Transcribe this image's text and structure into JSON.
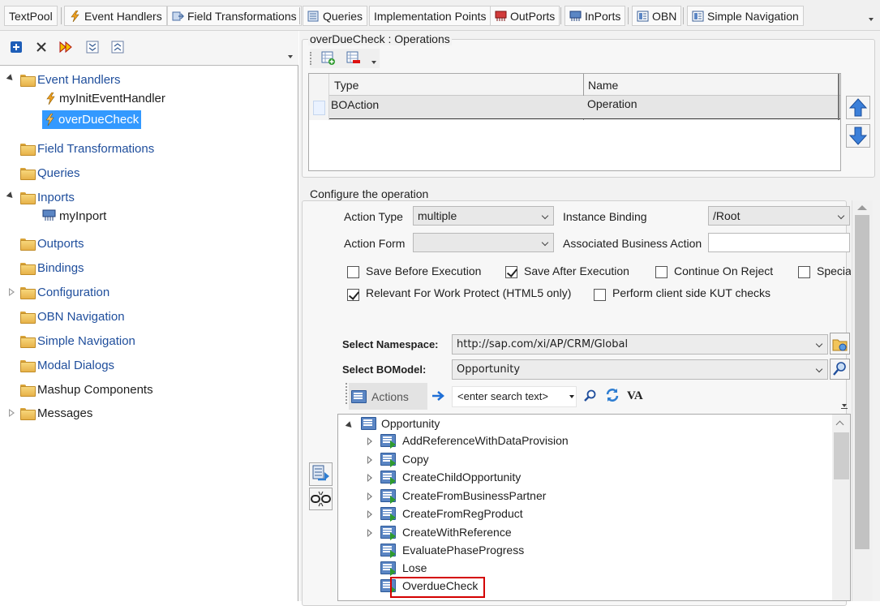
{
  "tabs": [
    {
      "label": "TextPool",
      "icon": "none"
    },
    {
      "label": "Event Handlers",
      "icon": "lightning-icon"
    },
    {
      "label": "Field Transformations",
      "icon": "transform-icon"
    },
    {
      "label": "Queries",
      "icon": "query-icon"
    },
    {
      "label": "Implementation Points",
      "icon": "none"
    },
    {
      "label": "OutPorts",
      "icon": "outport-icon"
    },
    {
      "label": "InPorts",
      "icon": "inport-icon"
    },
    {
      "label": "OBN",
      "icon": "obn-icon"
    },
    {
      "label": "Simple Navigation",
      "icon": "navigation-icon"
    }
  ],
  "tree": {
    "event_handlers": "Event Handlers",
    "my_init_event_handler": "myInitEventHandler",
    "over_due_check": "overDueCheck",
    "field_transformations": "Field Transformations",
    "queries": "Queries",
    "inports": "Inports",
    "my_inport": "myInport",
    "outports": "Outports",
    "bindings": "Bindings",
    "configuration": "Configuration",
    "obn_navigation": "OBN Navigation",
    "simple_navigation": "Simple Navigation",
    "modal_dialogs": "Modal Dialogs",
    "mashup_components": "Mashup Components",
    "messages": "Messages"
  },
  "operations": {
    "title": "overDueCheck : Operations",
    "columns": [
      "Type",
      "Name"
    ],
    "rows": [
      {
        "type": "BOAction",
        "name": "Operation"
      }
    ]
  },
  "configure": {
    "title": "Configure the operation",
    "action_type_label": "Action Type",
    "action_type_value": "multiple",
    "instance_binding_label": "Instance Binding",
    "instance_binding_value": "/Root",
    "action_form_label": "Action Form",
    "action_form_value": "",
    "associated_business_action_label": "Associated Business Action",
    "associated_business_action_value": "",
    "save_before_execution": "Save Before Execution",
    "save_after_execution": "Save After Execution",
    "continue_on_reject": "Continue On Reject",
    "special": "Special",
    "relevant_for_work_protect": "Relevant For Work Protect (HTML5 only)",
    "perform_client_side_kut_checks": "Perform client side KUT checks",
    "checkboxes": {
      "save_before": false,
      "save_after": true,
      "continue_on_reject": false,
      "special": false,
      "relevant_for_work_protect": true,
      "perform_kut": false
    },
    "select_namespace_label": "Select Namespace:",
    "select_namespace_value": "http://sap.com/xi/AP/CRM/Global",
    "select_bomodel_label": "Select BOModel:",
    "select_bomodel_value": "Opportunity",
    "actions_label": "Actions",
    "search_placeholder": "<enter search text>",
    "va_label": "VA"
  },
  "bo_tree": {
    "root": "Opportunity",
    "items": [
      "AddReferenceWithDataProvision",
      "Copy",
      "CreateChildOpportunity",
      "CreateFromBusinessPartner",
      "CreateFromRegProduct",
      "CreateWithReference",
      "EvaluatePhaseProgress",
      "Lose",
      "OverdueCheck"
    ]
  },
  "colors": {
    "selection": "#3399ff",
    "highlight_border": "#d40000",
    "tree_link": "#1f4e9c"
  }
}
